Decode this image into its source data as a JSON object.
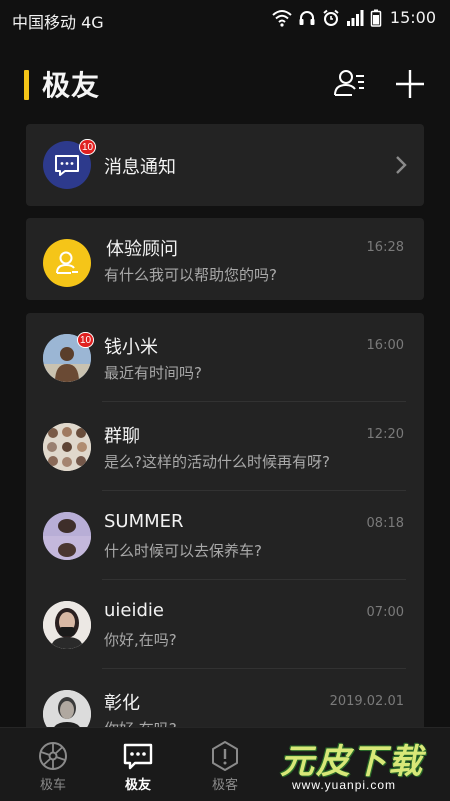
{
  "status": {
    "carrier": "中国移动 4G",
    "time": "15:00"
  },
  "header": {
    "title": "极友"
  },
  "notice": {
    "label": "消息通知",
    "badge": "10"
  },
  "advisor": {
    "name": "体验顾问",
    "message": "有什么我可以帮助您的吗?",
    "time": "16:28"
  },
  "chats": [
    {
      "name": "钱小米",
      "message": "最近有时间吗?",
      "time": "16:00",
      "badge": "10"
    },
    {
      "name": "群聊",
      "message": "是么?这样的活动什么时候再有呀?",
      "time": "12:20"
    },
    {
      "name": "SUMMER",
      "message": "什么时候可以去保养车?",
      "time": "08:18"
    },
    {
      "name": "uieidie",
      "message": "你好,在吗?",
      "time": "07:00"
    },
    {
      "name": "彰化",
      "message": "你好,在吗?",
      "time": "2019.02.01"
    }
  ],
  "tabs": [
    {
      "label": "极车",
      "icon": "wheel-icon"
    },
    {
      "label": "极友",
      "icon": "chat-icon"
    },
    {
      "label": "极客",
      "icon": "info-shield-icon"
    }
  ],
  "watermark": {
    "text": "元皮下载",
    "url": "www.yuanpi.com"
  },
  "colors": {
    "accent": "#f5c518",
    "badge": "#e02020",
    "notice_avatar": "#2d3a8c"
  }
}
